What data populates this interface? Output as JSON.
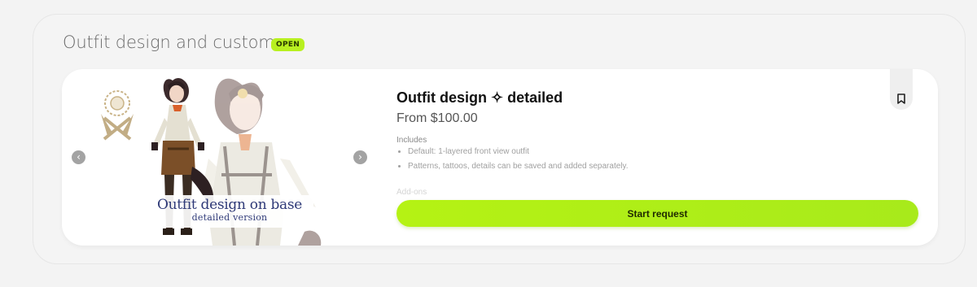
{
  "section": {
    "title": "Outfit design and customs",
    "status_badge": "OPEN"
  },
  "card": {
    "title": "Outfit design ✧ detailed",
    "price": "From $100.00",
    "includes_label": "Includes",
    "includes": [
      "Default: 1-layered front view outfit",
      "Patterns, tattoos, details can be saved and added separately."
    ],
    "faded_text": "Add-ons",
    "cta_label": "Start request",
    "gallery": {
      "caption_main": "Outfit design on base",
      "caption_sub": "detailed version",
      "prev_icon": "chevron-left-icon",
      "next_icon": "chevron-right-icon"
    },
    "bookmark_icon": "bookmark-icon"
  },
  "colors": {
    "accent": "#b5f214",
    "badge_bg": "#b8f020",
    "page_bg": "#f3f3f3",
    "card_bg": "#ffffff"
  }
}
